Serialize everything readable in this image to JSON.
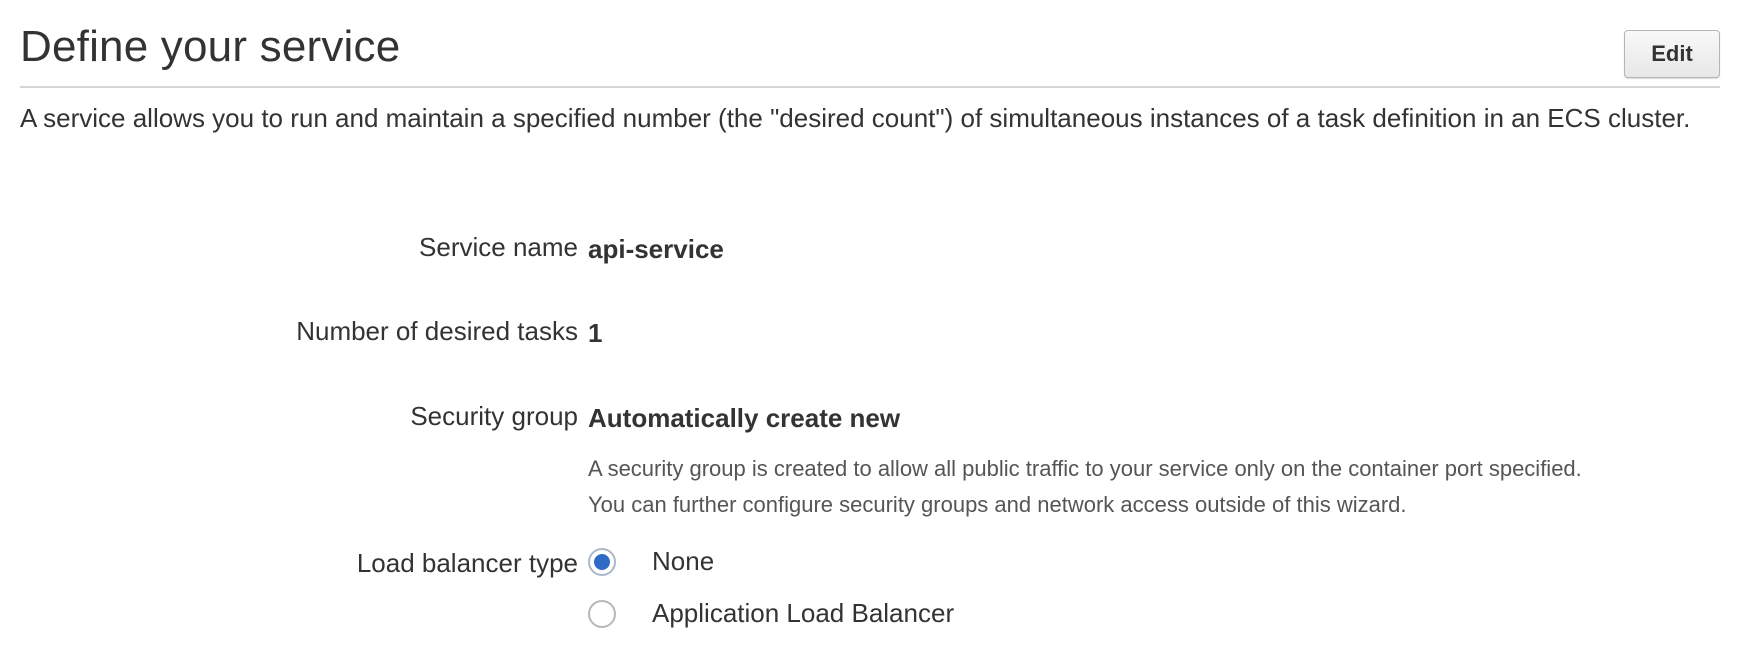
{
  "section": {
    "title": "Define your service",
    "edit_label": "Edit",
    "description": "A service allows you to run and maintain a specified number (the \"desired count\") of simultaneous instances of a task definition in an ECS cluster."
  },
  "fields": {
    "service_name": {
      "label": "Service name",
      "value": "api-service"
    },
    "desired_tasks": {
      "label": "Number of desired tasks",
      "value": "1"
    },
    "security_group": {
      "label": "Security group",
      "value": "Automatically create new",
      "help_line1": "A security group is created to allow all public traffic to your service only on the container port specified.",
      "help_line2": "You can further configure security groups and network access outside of this wizard."
    },
    "load_balancer": {
      "label": "Load balancer type",
      "selected": "None",
      "options": [
        {
          "label": "None",
          "checked": true
        },
        {
          "label": "Application Load Balancer",
          "checked": false
        }
      ]
    }
  },
  "colors": {
    "radio_selected": "#2e6bc4",
    "divider": "#d5d5d5",
    "text": "#333333"
  }
}
